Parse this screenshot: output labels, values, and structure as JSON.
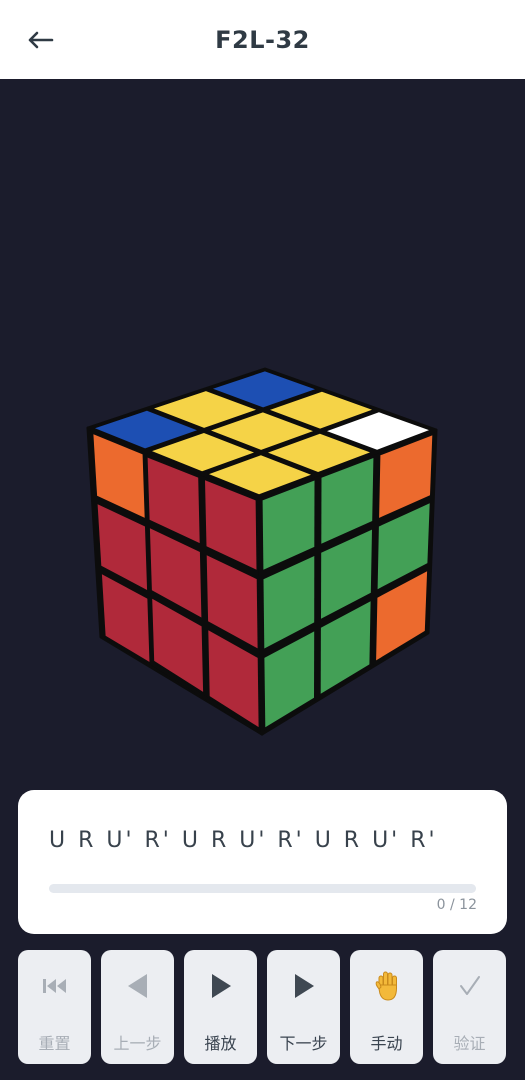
{
  "header": {
    "title": "F2L-32",
    "back_icon": "arrow-left-icon"
  },
  "cube": {
    "colors": {
      "red": "#b0293a",
      "green": "#43a056",
      "yellow": "#f5d347",
      "blue": "#1d4fb3",
      "orange": "#ec6a2e",
      "white": "#ffffff",
      "border": "#0c0c0c"
    },
    "top_face": [
      [
        "blue",
        "yellow",
        "blue"
      ],
      [
        "yellow",
        "yellow",
        "yellow"
      ],
      [
        "yellow",
        "yellow",
        "white"
      ]
    ],
    "front_face": [
      [
        "red",
        "red",
        "green"
      ],
      [
        "red",
        "red",
        "green"
      ],
      [
        "red",
        "red",
        "green"
      ]
    ],
    "right_face": [
      [
        "green",
        "green",
        "orange"
      ],
      [
        "green",
        "green",
        "green"
      ],
      [
        "green",
        "green",
        "orange"
      ]
    ],
    "left_face_visible": [
      [
        "orange",
        "red"
      ],
      [
        "red",
        "red"
      ],
      [
        "red",
        "red"
      ]
    ]
  },
  "algorithm": {
    "text": "U R U' R' U R U' R' U R U' R'",
    "current_step": 0,
    "total_steps": 12,
    "progress_label": "0 / 12"
  },
  "controls": [
    {
      "id": "reset",
      "label": "重置",
      "icon": "skip-to-start-icon",
      "enabled": false
    },
    {
      "id": "prev",
      "label": "上一步",
      "icon": "step-back-icon",
      "enabled": false
    },
    {
      "id": "play",
      "label": "播放",
      "icon": "play-icon",
      "enabled": true
    },
    {
      "id": "next",
      "label": "下一步",
      "icon": "step-forward-icon",
      "enabled": true
    },
    {
      "id": "manual",
      "label": "手动",
      "icon": "raised-hand-icon",
      "enabled": true
    },
    {
      "id": "verify",
      "label": "验证",
      "icon": "checkmark-icon",
      "enabled": false
    }
  ],
  "theme": {
    "background": "#1b1c2c",
    "card": "#ffffff",
    "button_bg": "#eceef2",
    "icon_active": "#3f4852",
    "icon_disabled": "#a8aeb6"
  }
}
